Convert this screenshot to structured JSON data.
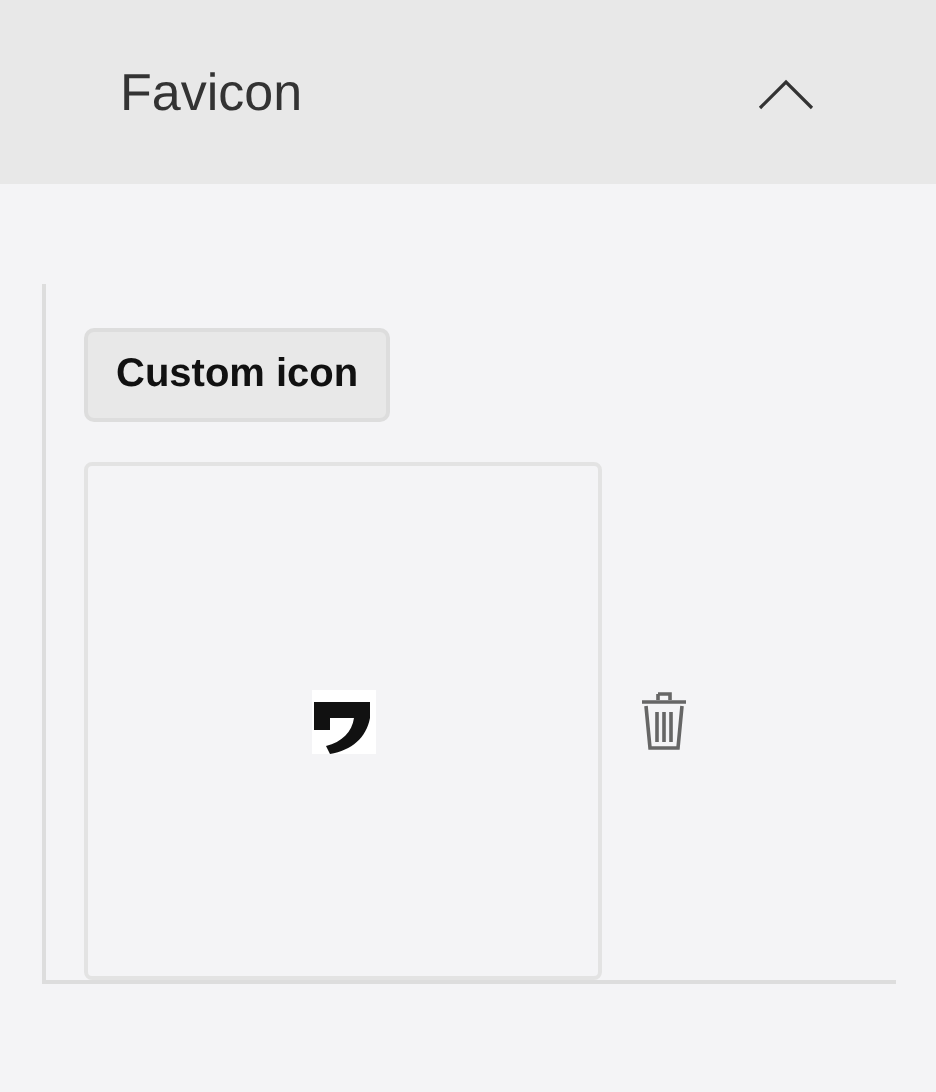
{
  "section": {
    "title": "Favicon",
    "expanded": true
  },
  "favicon": {
    "button": "Custom icon"
  }
}
